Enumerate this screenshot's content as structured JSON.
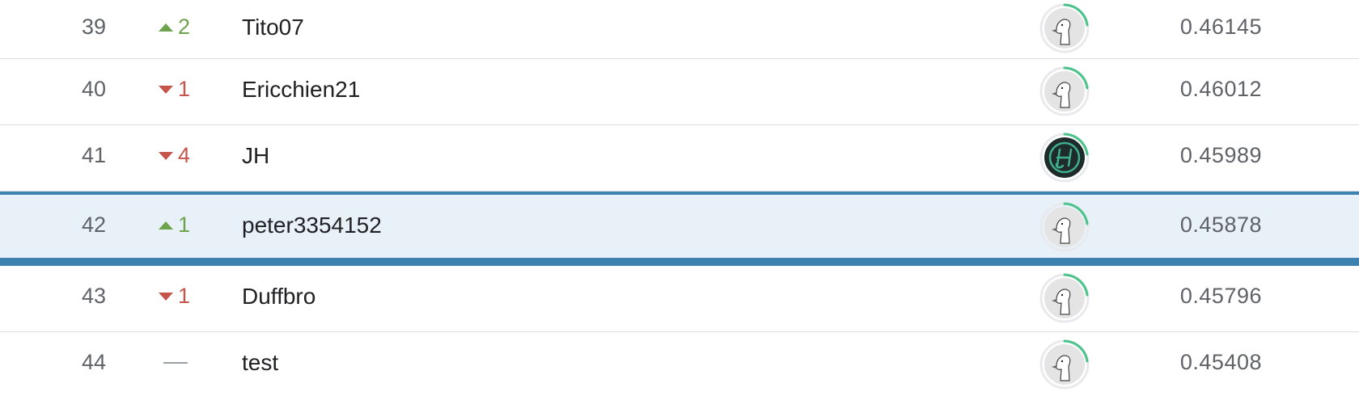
{
  "leaderboard": {
    "rows": [
      {
        "rank": "39",
        "change_direction": "up",
        "change": "2",
        "team": "Tito07",
        "avatar_icon": "goose-avatar-icon",
        "score": "0.46145"
      },
      {
        "rank": "40",
        "change_direction": "down",
        "change": "1",
        "team": "Ericchien21",
        "avatar_icon": "goose-avatar-icon",
        "score": "0.46012"
      },
      {
        "rank": "41",
        "change_direction": "down",
        "change": "4",
        "team": "JH",
        "avatar_icon": "jh-logo-avatar-icon",
        "score": "0.45989"
      },
      {
        "rank": "42",
        "change_direction": "up",
        "change": "1",
        "team": "peter3354152",
        "avatar_icon": "goose-avatar-icon",
        "score": "0.45878",
        "is_current_user": true
      },
      {
        "rank": "43",
        "change_direction": "down",
        "change": "1",
        "team": "Duffbro",
        "avatar_icon": "goose-avatar-icon",
        "score": "0.45796"
      },
      {
        "rank": "44",
        "change_direction": "none",
        "change": "",
        "team": "test",
        "avatar_icon": "goose-avatar-icon",
        "score": "0.45408"
      }
    ],
    "colors": {
      "up": "#6da34d",
      "down": "#c5554a",
      "highlight_bg": "#e8f0f8",
      "highlight_border": "#3d81b1",
      "progress_ring": "#4cc38a"
    }
  }
}
